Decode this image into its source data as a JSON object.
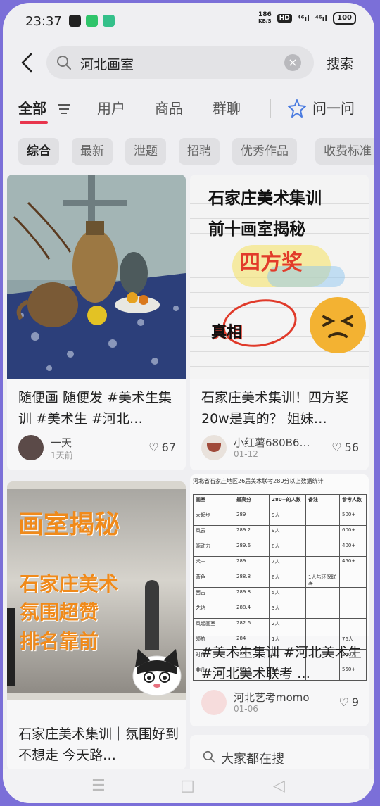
{
  "status": {
    "time": "23:37",
    "net_speed_top": "186",
    "net_speed_unit": "KB/S",
    "hd": "HD",
    "signal1": "⁴⁶ıl",
    "signal2": "⁴⁶ıl",
    "battery": "100"
  },
  "search": {
    "query": "河北画室",
    "button": "搜索"
  },
  "tabs": [
    "全部",
    "用户",
    "商品",
    "群聊",
    "问一问"
  ],
  "filters": [
    "综合",
    "最新",
    "泄题",
    "招聘",
    "优秀作品",
    "收费标准"
  ],
  "cards": [
    {
      "title": "随便画 随便发 #美术生集训 #美术生 #河北…",
      "author": "一天",
      "date": "1天前",
      "likes": "67"
    },
    {
      "title": "石家庄美术集训！四方奖20w是真的？ 姐妹…",
      "author": "小红薯680B6…",
      "date": "01-12",
      "likes": "56",
      "cover": {
        "line1": "石家庄美术集训",
        "line2": "前十画室揭秘",
        "highlight": "四方奖",
        "circle": "真相"
      }
    },
    {
      "title": "#美术生集训 #河北美术生 #河北美术联考 …",
      "author": "河北艺考momo",
      "date": "01-06",
      "likes": "9",
      "sheet": {
        "heading": "河北省石家庄地区26届美术联考280分以上数据统计",
        "headers": [
          "画室",
          "最高分",
          "280+的人数",
          "备注",
          "参考人数"
        ],
        "rows": [
          [
            "大起步",
            "289",
            "9人",
            "",
            "500+"
          ],
          [
            "风云",
            "289.2",
            "9人",
            "",
            "600+"
          ],
          [
            "源动力",
            "289.6",
            "8人",
            "",
            "400+"
          ],
          [
            "禾丰",
            "289",
            "7人",
            "",
            "450+"
          ],
          [
            "蓝色",
            "288.8",
            "6人",
            "1人与环保联考",
            ""
          ],
          [
            "西吉",
            "289.8",
            "5人",
            "",
            ""
          ],
          [
            "艺坊",
            "288.4",
            "3人",
            "",
            ""
          ],
          [
            "风起画室",
            "282.6",
            "2人",
            "",
            ""
          ],
          [
            "领航",
            "284",
            "1人",
            "",
            "76人"
          ],
          [
            "时代",
            "288.6",
            "1人",
            "",
            "240人"
          ],
          [
            "非凡",
            "288.8",
            "1人",
            "",
            "550+"
          ]
        ]
      }
    },
    {
      "title": "石家庄美术集训｜氛围好到不想走 今天路…",
      "cover": {
        "line1": "画室揭秘",
        "line2": "石家庄美术",
        "line3": "氛围超赞",
        "line4": "排名靠前"
      }
    }
  ],
  "suggest": "大家都在搜",
  "colors": {
    "accent": "#e8354d",
    "frame": "#7b6fd8"
  }
}
